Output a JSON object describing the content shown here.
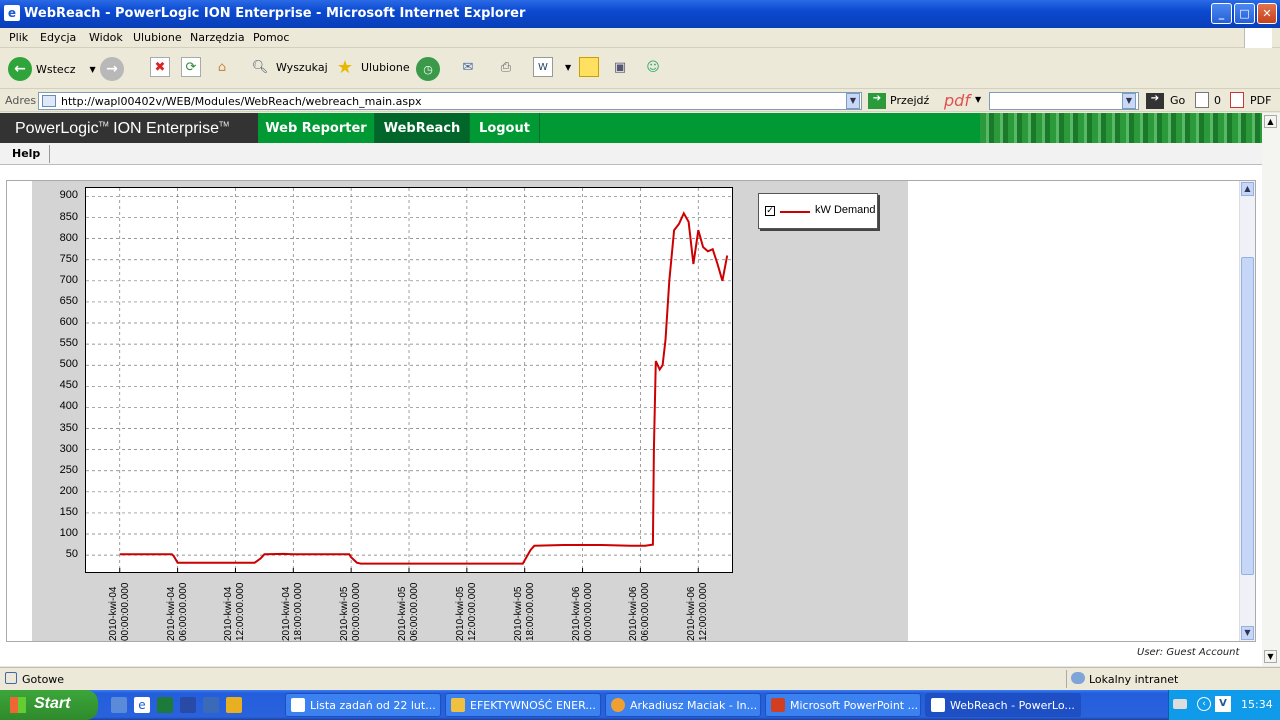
{
  "window": {
    "title": "WebReach - PowerLogic ION Enterprise - Microsoft Internet Explorer"
  },
  "menu": [
    "Plik",
    "Edycja",
    "Widok",
    "Ulubione",
    "Narzędzia",
    "Pomoc"
  ],
  "toolbar": {
    "back": "Wstecz",
    "search": "Wyszukaj",
    "favorites": "Ulubione"
  },
  "address": {
    "label": "Adres",
    "url": "http://wapl00402v/WEB/Modules/WebReach/webreach_main.aspx",
    "go": "Przejdź",
    "pdf": "pdf",
    "go2": "Go",
    "count": "0",
    "pdf2": "PDF"
  },
  "app": {
    "brand_a": "PowerLogic",
    "brand_tm1": "TM",
    "brand_b": " ION Enterprise",
    "brand_tm2": "TM",
    "nav": [
      "Web Reporter",
      "WebReach",
      "Logout"
    ],
    "help": "Help",
    "user": "User: Guest Account"
  },
  "chart_data": {
    "type": "line",
    "y_ticks": [
      "900",
      "850",
      "800",
      "750",
      "700",
      "650",
      "600",
      "550",
      "500",
      "450",
      "400",
      "350",
      "300",
      "250",
      "200",
      "150",
      "100",
      "50"
    ],
    "ylim": [
      10,
      920
    ],
    "x_ticks": [
      [
        "2010-kwi-04",
        "00:00:00.000"
      ],
      [
        "2010-kwi-04",
        "06:00:00.000"
      ],
      [
        "2010-kwi-04",
        "12:00:00.000"
      ],
      [
        "2010-kwi-04",
        "18:00:00.000"
      ],
      [
        "2010-kwi-05",
        "00:00:00.000"
      ],
      [
        "2010-kwi-05",
        "06:00:00.000"
      ],
      [
        "2010-kwi-05",
        "12:00:00.000"
      ],
      [
        "2010-kwi-05",
        "18:00:00.000"
      ],
      [
        "2010-kwi-06",
        "00:00:00.000"
      ],
      [
        "2010-kwi-06",
        "06:00:00.000"
      ],
      [
        "2010-kwi-06",
        "12:00:00.000"
      ]
    ],
    "xlim_hours": [
      -3.5,
      63.5
    ],
    "grid": true,
    "legend": "right",
    "series": [
      {
        "name": "kW Demand",
        "color": "#cc0000",
        "x_hours": [
          0,
          5.4,
          5.6,
          6,
          14,
          14.6,
          15,
          17,
          18,
          23.8,
          24,
          24.6,
          25,
          30,
          35,
          41.8,
          42.6,
          43,
          46,
          50,
          53,
          54.5,
          55.3,
          55.4,
          55.6,
          56,
          56.3,
          56.6,
          57,
          57.5,
          58,
          58.5,
          59,
          59.5,
          60,
          60.5,
          61,
          61.5,
          62,
          62.5,
          63
        ],
        "kw": [
          52,
          52,
          48,
          32,
          32,
          42,
          52,
          53,
          52,
          52,
          45,
          32,
          30,
          30,
          30,
          30,
          62,
          72,
          74,
          74,
          72,
          72,
          75,
          300,
          510,
          490,
          500,
          560,
          700,
          820,
          835,
          860,
          840,
          740,
          820,
          780,
          770,
          775,
          740,
          700,
          760
        ]
      }
    ]
  },
  "status": {
    "ready": "Gotowe",
    "zone": "Lokalny intranet"
  },
  "taskbar": {
    "start": "Start",
    "tasks": [
      "Lista zadań od 22 lut...",
      "EFEKTYWNOŚĆ ENER...",
      "Arkadiusz Maciak - In...",
      "Microsoft PowerPoint ...",
      "WebReach - PowerLo..."
    ],
    "clock": "15:34"
  }
}
